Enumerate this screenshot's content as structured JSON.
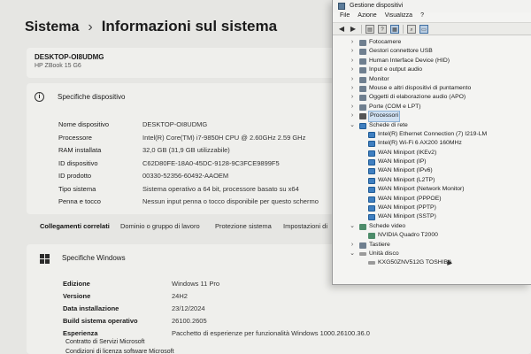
{
  "settings": {
    "breadcrumb": {
      "parent": "Sistema",
      "separator": "›",
      "current": "Informazioni sul sistema"
    },
    "device": {
      "name": "DESKTOP-OI8UDMG",
      "model": "HP ZBook 15 G6"
    },
    "specs": {
      "title": "Specifiche dispositivo",
      "rows": [
        {
          "label": "Nome dispositivo",
          "value": "DESKTOP-OI8UDMG"
        },
        {
          "label": "Processore",
          "value": "Intel(R) Core(TM) i7-9850H CPU @ 2.60GHz   2.59 GHz"
        },
        {
          "label": "RAM installata",
          "value": "32,0 GB (31,9 GB utilizzabile)"
        },
        {
          "label": "ID dispositivo",
          "value": "C62D80FE-18A0-45DC-9128-9C3FCE9899F5"
        },
        {
          "label": "ID prodotto",
          "value": "00330-52356-60492-AAOEM"
        },
        {
          "label": "Tipo sistema",
          "value": "Sistema operativo a 64 bit, processore basato su x64"
        },
        {
          "label": "Penna e tocco",
          "value": "Nessun input penna o tocco disponibile per questo schermo"
        }
      ]
    },
    "related": {
      "label": "Collegamenti correlati",
      "links": [
        "Dominio o gruppo di lavoro",
        "Protezione sistema",
        "Impostazioni di"
      ]
    },
    "windows": {
      "title": "Specifiche Windows",
      "rows": [
        {
          "label": "Edizione",
          "value": "Windows 11 Pro"
        },
        {
          "label": "Versione",
          "value": "24H2"
        },
        {
          "label": "Data installazione",
          "value": "23/12/2024"
        },
        {
          "label": "Build sistema operativo",
          "value": "26100.2605"
        },
        {
          "label": "Esperienza",
          "value": "Pacchetto di esperienze per funzionalità Windows 1000.26100.36.0"
        }
      ],
      "links": [
        "Contratto di Servizi Microsoft",
        "Condizioni di licenza software Microsoft"
      ]
    }
  },
  "device_manager": {
    "title": "Gestione dispositivi",
    "menu": [
      "File",
      "Azione",
      "Visualizza",
      "?"
    ],
    "toolbar_icons": [
      "back-arrow-icon",
      "forward-arrow-icon",
      "properties-icon",
      "help-icon",
      "update-driver-icon",
      "scan-hardware-icon",
      "monitor-icon"
    ],
    "tree": [
      {
        "label": "Fotocamere",
        "level": 0,
        "state": "collapsed",
        "icon": "camera-icon"
      },
      {
        "label": "Gestori connettore USB",
        "level": 0,
        "state": "collapsed",
        "icon": "usb-connector-icon"
      },
      {
        "label": "Human Interface Device (HID)",
        "level": 0,
        "state": "collapsed",
        "icon": "hid-icon"
      },
      {
        "label": "Input e output audio",
        "level": 0,
        "state": "collapsed",
        "icon": "audio-icon"
      },
      {
        "label": "Monitor",
        "level": 0,
        "state": "collapsed",
        "icon": "monitor-icon"
      },
      {
        "label": "Mouse e altri dispositivi di puntamento",
        "level": 0,
        "state": "collapsed",
        "icon": "mouse-icon"
      },
      {
        "label": "Oggetti di elaborazione audio (APO)",
        "level": 0,
        "state": "collapsed",
        "icon": "apo-icon"
      },
      {
        "label": "Porte (COM e LPT)",
        "level": 0,
        "state": "collapsed",
        "icon": "port-icon"
      },
      {
        "label": "Processori",
        "level": 0,
        "state": "collapsed",
        "icon": "processor-icon",
        "selected": true
      },
      {
        "label": "Schede di rete",
        "level": 0,
        "state": "expanded",
        "icon": "network-adapter-icon"
      },
      {
        "label": "Intel(R) Ethernet Connection (7) I219-LM",
        "level": 1,
        "icon": "network-adapter-icon"
      },
      {
        "label": "Intel(R) Wi-Fi 6 AX200 160MHz",
        "level": 1,
        "icon": "network-adapter-icon"
      },
      {
        "label": "WAN Miniport (IKEv2)",
        "level": 1,
        "icon": "network-adapter-icon"
      },
      {
        "label": "WAN Miniport (IP)",
        "level": 1,
        "icon": "network-adapter-icon"
      },
      {
        "label": "WAN Miniport (IPv6)",
        "level": 1,
        "icon": "network-adapter-icon"
      },
      {
        "label": "WAN Miniport (L2TP)",
        "level": 1,
        "icon": "network-adapter-icon"
      },
      {
        "label": "WAN Miniport (Network Monitor)",
        "level": 1,
        "icon": "network-adapter-icon"
      },
      {
        "label": "WAN Miniport (PPPOE)",
        "level": 1,
        "icon": "network-adapter-icon"
      },
      {
        "label": "WAN Miniport (PPTP)",
        "level": 1,
        "icon": "network-adapter-icon"
      },
      {
        "label": "WAN Miniport (SSTP)",
        "level": 1,
        "icon": "network-adapter-icon"
      },
      {
        "label": "Schede video",
        "level": 0,
        "state": "expanded",
        "icon": "display-adapter-icon"
      },
      {
        "label": "NVIDIA Quadro T2000",
        "level": 1,
        "icon": "display-adapter-icon"
      },
      {
        "label": "Tastiere",
        "level": 0,
        "state": "collapsed",
        "icon": "keyboard-icon"
      },
      {
        "label": "Unità disco",
        "level": 0,
        "state": "expanded",
        "icon": "disk-drive-icon"
      },
      {
        "label": "KXG50ZNV512G TOSHIBA",
        "level": 1,
        "icon": "disk-drive-icon"
      }
    ]
  }
}
